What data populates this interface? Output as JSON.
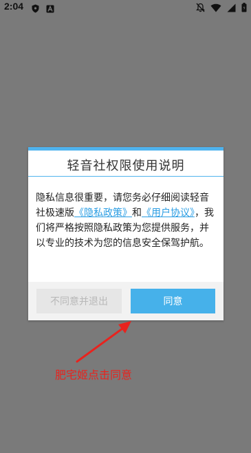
{
  "status_bar": {
    "time": "2:04",
    "left_icons": [
      "shield-icon",
      "a-letter-icon"
    ],
    "right_icons": [
      "notifications-off-icon",
      "wifi-icon",
      "signal-icon",
      "battery-icon"
    ]
  },
  "dialog": {
    "title": "轻音社权限使用说明",
    "body": {
      "text_before": "隐私信息很重要，请您务必仔细阅读轻音社极速版",
      "privacy_link": "《隐私政策》",
      "and_text": "和",
      "terms_link": "《用户协议》",
      "text_after": "，我们将严格按照隐私政策为您提供服务，并以专业的技术为您的信息安全保驾护航。"
    },
    "disagree_label": "不同意并退出",
    "agree_label": "同意"
  },
  "annotation": {
    "text": "肥宅姬点击同意",
    "color": "#e8231e"
  },
  "colors": {
    "accent": "#46b1ea",
    "link": "#2a9de3",
    "overlay": "#7a7a7a"
  }
}
